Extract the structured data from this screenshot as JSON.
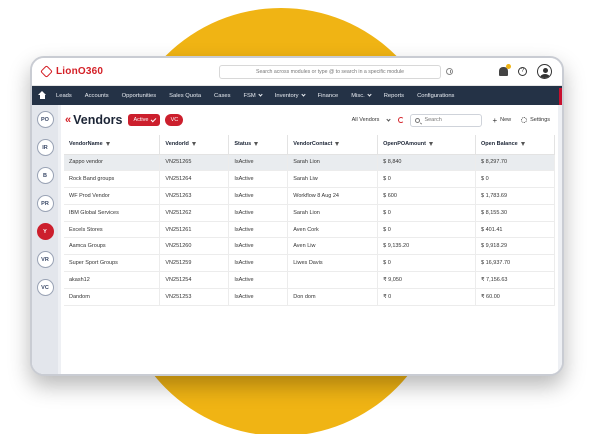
{
  "app": {
    "logo_text": "LionO360"
  },
  "topbar": {
    "search_placeholder": "Search across modules or type @ to search in a specific module",
    "icons": [
      "clock-icon",
      "bell-icon",
      "help-icon",
      "avatar-icon"
    ]
  },
  "nav": {
    "items": [
      {
        "label": "Leads",
        "dropdown": false
      },
      {
        "label": "Accounts",
        "dropdown": false
      },
      {
        "label": "Opportunities",
        "dropdown": false
      },
      {
        "label": "Sales Quota",
        "dropdown": false
      },
      {
        "label": "Cases",
        "dropdown": false
      },
      {
        "label": "FSM",
        "dropdown": true
      },
      {
        "label": "Inventory",
        "dropdown": true
      },
      {
        "label": "Finance",
        "dropdown": false
      },
      {
        "label": "Misc.",
        "dropdown": true
      },
      {
        "label": "Reports",
        "dropdown": false
      },
      {
        "label": "Configurations",
        "dropdown": false
      }
    ]
  },
  "sidebar": {
    "items": [
      "PO",
      "IR",
      "B",
      "PR",
      "Y",
      "VR",
      "VC"
    ],
    "active_index": 4
  },
  "page": {
    "title": "Vendors",
    "status_pill": "Active",
    "tag_pill": "VC",
    "view": "All Vendors",
    "search_placeholder": "Search",
    "new_label": "New",
    "settings_label": "Settings"
  },
  "table": {
    "columns": [
      "VendorName",
      "VendorId",
      "Status",
      "VendorContact",
      "OpenPOAmount",
      "Open Balance"
    ],
    "rows": [
      [
        "Zappo vendor",
        "VN251265",
        "IsActive",
        "Sarah Lion",
        "$ 8,840",
        "$ 8,297.70"
      ],
      [
        "Rock Band groups",
        "VN251264",
        "IsActive",
        "Sarah Liw",
        "$ 0",
        "$ 0"
      ],
      [
        "WF Prod Vendor",
        "VN251263",
        "IsActive",
        "Workflow 8 Aug 24",
        "$ 600",
        "$ 1,783.69"
      ],
      [
        "IBM Global Services",
        "VN251262",
        "IsActive",
        "Sarah Lion",
        "$ 0",
        "$ 8,155.30"
      ],
      [
        "Excels Stores",
        "VN251261",
        "IsActive",
        "Aven Cork",
        "$ 0",
        "$ 401.41"
      ],
      [
        "Aamca Groups",
        "VN251260",
        "IsActive",
        "Aven Liw",
        "$ 9,135.20",
        "$ 9,918.29"
      ],
      [
        "Super Sport Groups",
        "VN251259",
        "IsActive",
        "Liwes Davis",
        "$ 0",
        "$ 16,937.70"
      ],
      [
        "akash12",
        "VN251254",
        "IsActive",
        "",
        "₹ 9,050",
        "₹ 7,156.63"
      ],
      [
        "Dandom",
        "VN251253",
        "IsActive",
        "Don dom",
        "₹ 0",
        "₹ 60.00"
      ]
    ],
    "selected_row": 0
  },
  "colors": {
    "brand_red": "#cc1f2d",
    "nav_bg": "#243246",
    "accent_yellow": "#f0b414"
  }
}
